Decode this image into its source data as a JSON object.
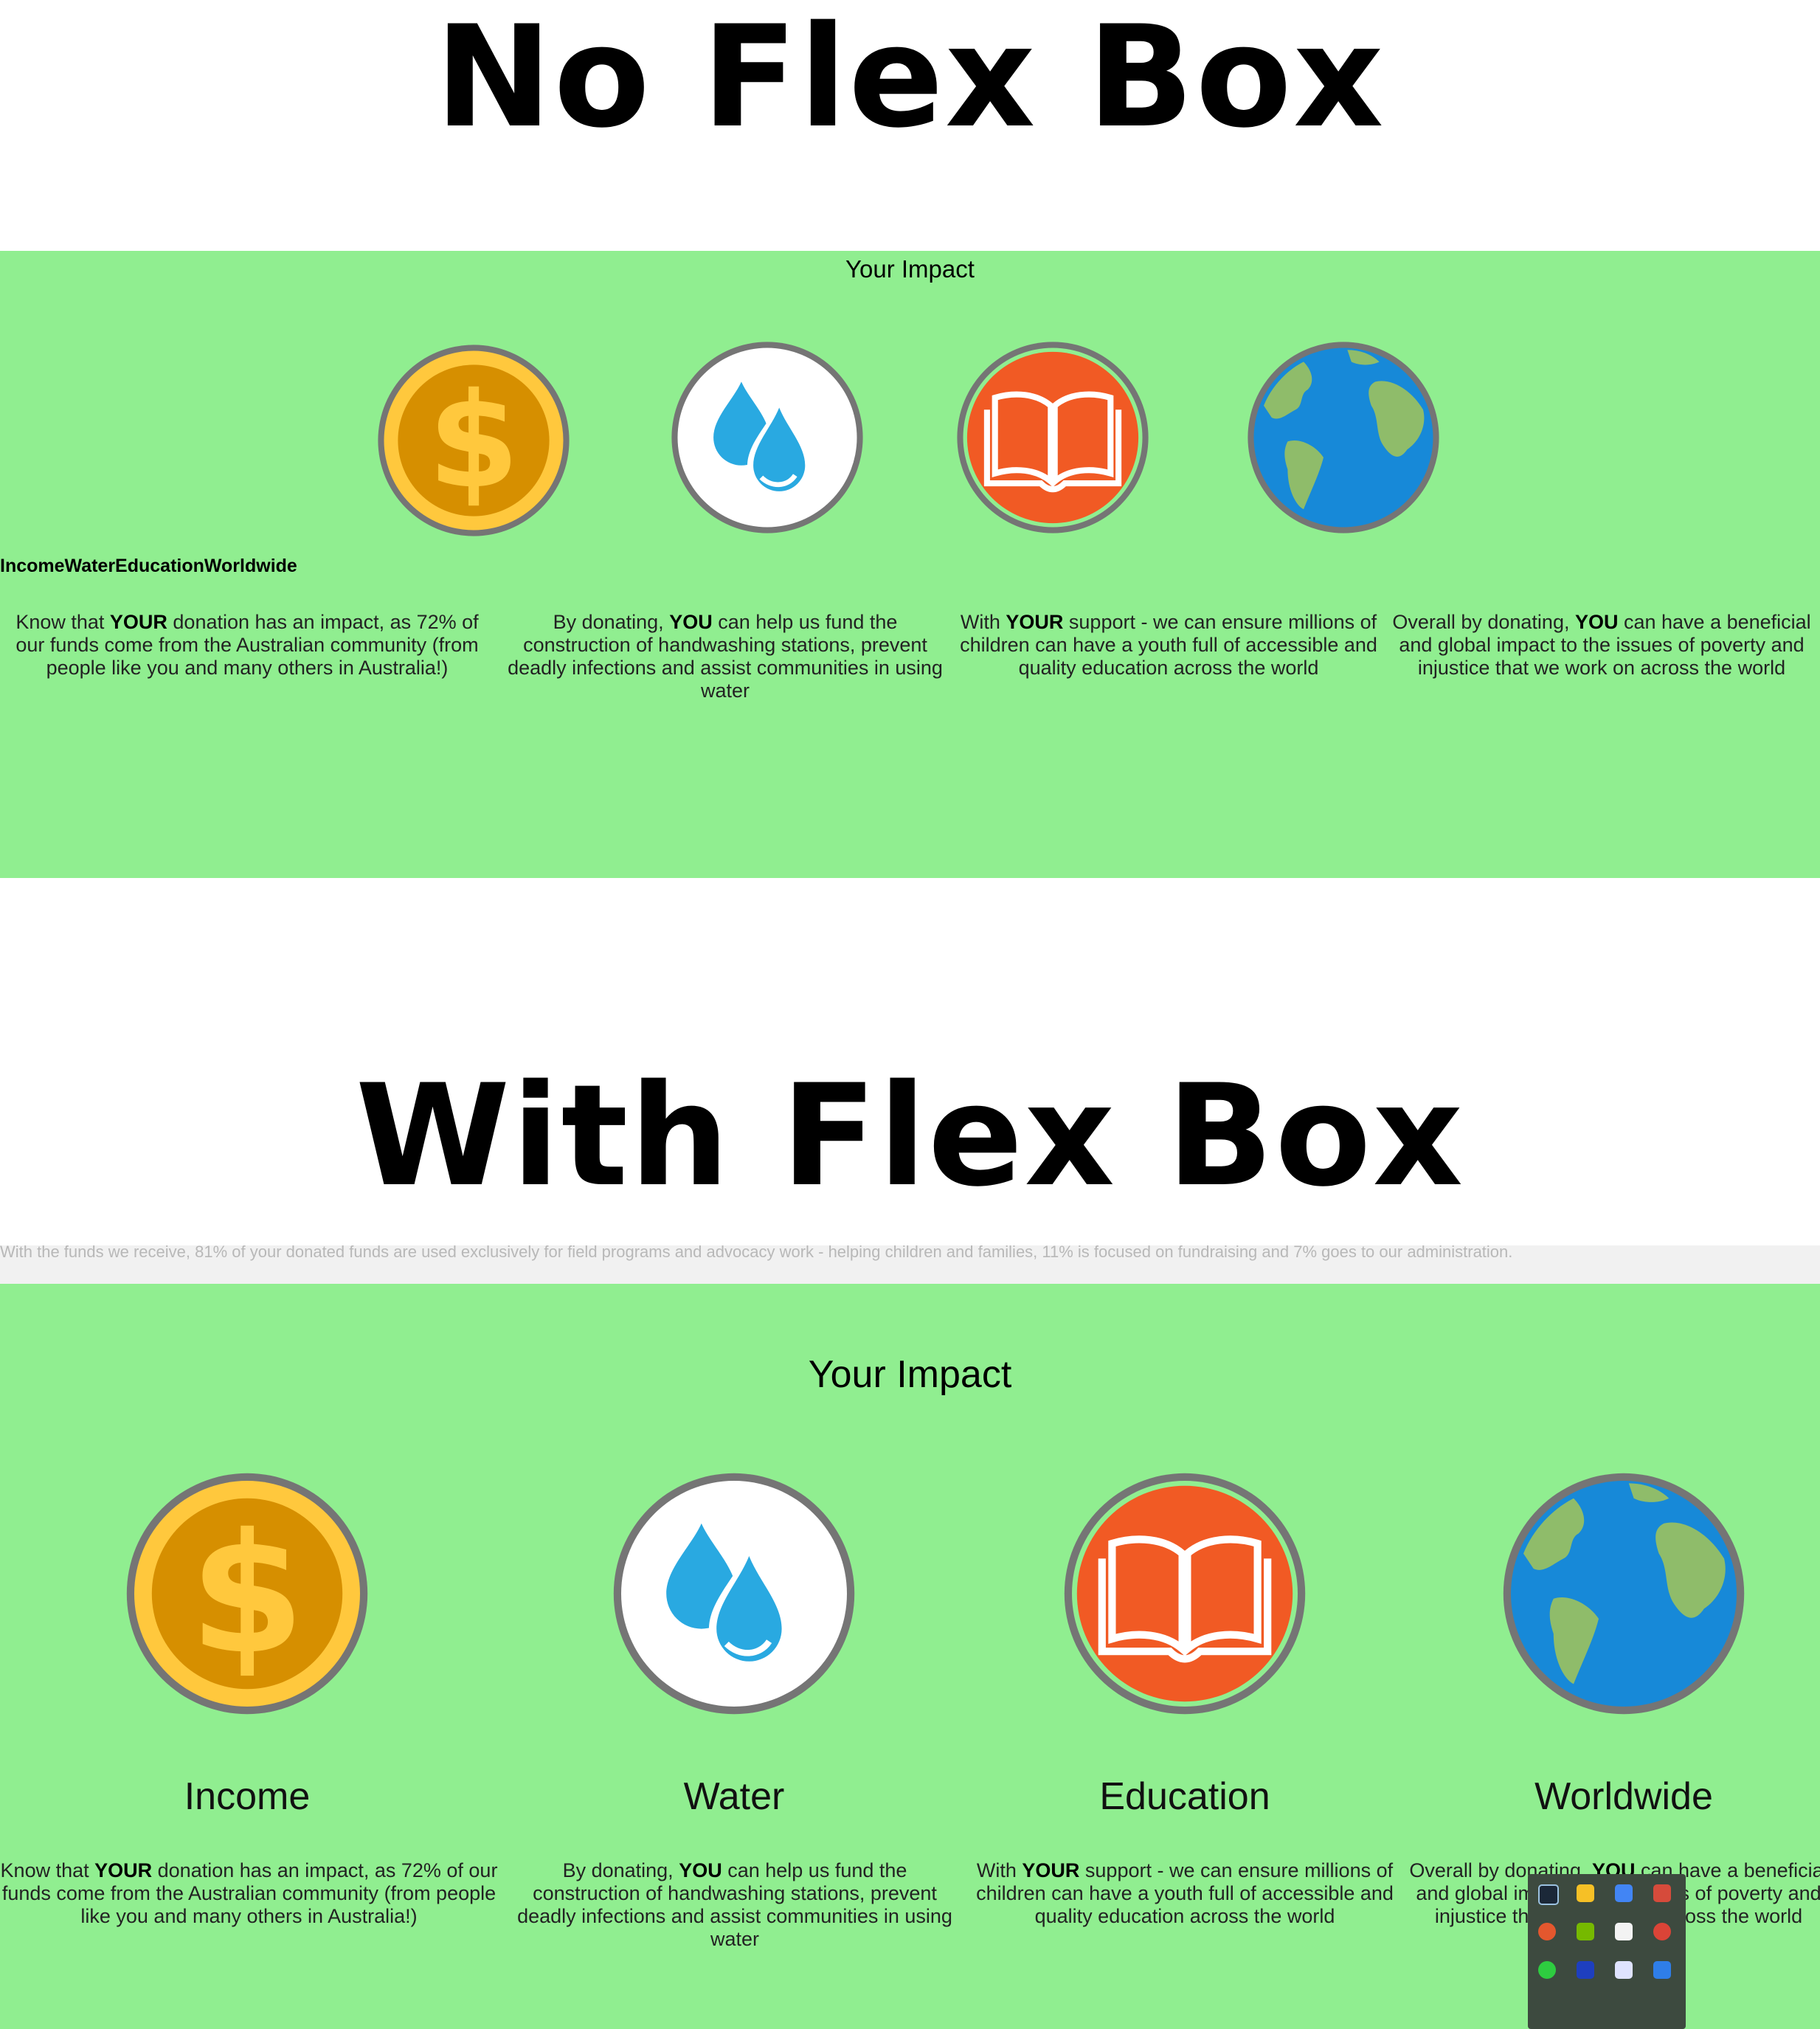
{
  "headings": {
    "top": "No Flex Box",
    "bottom": "With Flex Box"
  },
  "impact_title": "Your Impact",
  "joined_labels": "IncomeWaterEducationWorldwide",
  "faded_line": "With the funds we receive, 81% of your donated funds are used exclusively for field programs and advocacy work - helping children and families, 11% is focused on fundraising and 7% goes to our administration.",
  "cards": [
    {
      "label": "Income",
      "icon": "dollar-coin-icon",
      "pre": "Know that ",
      "strong": "YOUR",
      "post": " donation has an impact, as 72% of our funds come from the Australian community (from people like you and many others in Australia!)"
    },
    {
      "label": "Water",
      "icon": "water-drops-icon",
      "pre": "By donating, ",
      "strong": "YOU",
      "post": " can help us fund the construction of handwashing stations, prevent deadly infections and assist communities in using water"
    },
    {
      "label": "Education",
      "icon": "open-book-icon",
      "pre": "With ",
      "strong": "YOUR",
      "post": " support - we can ensure millions of children can have a youth full of accessible and quality education across the world"
    },
    {
      "label": "Worldwide",
      "icon": "globe-icon",
      "pre": "Overall by donating, ",
      "strong": "YOU",
      "post": " can have a beneficial and global impact to the issues of poverty and injustice that we work on across the world"
    }
  ],
  "colors": {
    "panel": "#90ee90",
    "coin": "#d68f00",
    "coin_rim": "#ffc83d",
    "book": "#f15a24",
    "water": "#29a9e1",
    "ocean": "#1789d8",
    "land": "#8fbc6a",
    "ring": "#757575"
  },
  "tray_icons": [
    "steam-icon",
    "chrome-icon",
    "chrome-icon",
    "app-icon",
    "app-icon",
    "nvidia-icon",
    "shield-icon",
    "chrome-icon",
    "app-icon",
    "app-icon",
    "discord-icon",
    "app-icon"
  ]
}
